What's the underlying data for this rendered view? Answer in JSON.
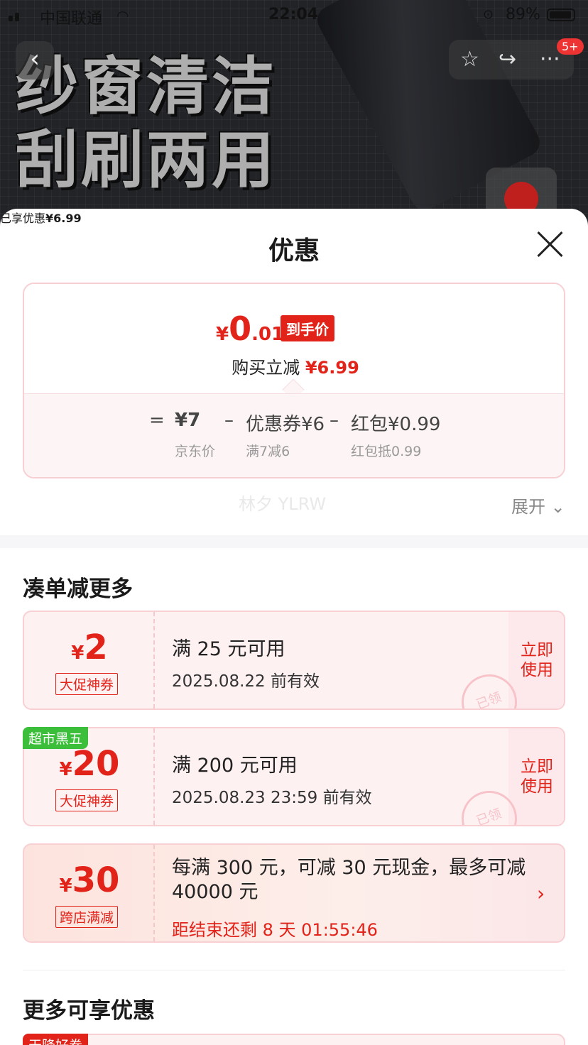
{
  "status_bar": {
    "carrier": "中国联通",
    "time": "22:04",
    "battery": "89%"
  },
  "background": {
    "product_line1": "纱窗清洁",
    "product_line2": "刮刷两用",
    "cart_badge": "5+"
  },
  "sheet": {
    "title": "优惠"
  },
  "price_card": {
    "currency": "¥",
    "price_int": "0",
    "price_dec": ".01",
    "price_tag": "到手价",
    "instant_label": "购买立减",
    "instant_value": "¥6.99",
    "formula": {
      "eq": "=",
      "jd_price": "¥7",
      "jd_price_label": "京东价",
      "minus1": "–",
      "coupon": "优惠券¥6",
      "coupon_label": "满7减6",
      "minus2": "–",
      "redpacket": "红包¥0.99",
      "redpacket_label": "红包抵0.99"
    }
  },
  "enjoyed": {
    "label": "已享优惠",
    "value": "¥6.99",
    "expand": "展开",
    "watermark": "林夕 YLRW"
  },
  "section1": {
    "title": "凑单减更多"
  },
  "coupons": [
    {
      "currency": "¥",
      "amount": "2",
      "type": "大促神券",
      "condition": "满 25 元可用",
      "valid": "2025.08.22 前有效",
      "action1": "立即",
      "action2": "使用",
      "stamp": "已领"
    },
    {
      "tag": "超市黑五",
      "currency": "¥",
      "amount": "20",
      "type": "大促神券",
      "condition": "满 200 元可用",
      "valid": "2025.08.23 23:59 前有效",
      "action1": "立即",
      "action2": "使用",
      "stamp": "已领"
    },
    {
      "currency": "¥",
      "amount": "30",
      "type": "跨店满减",
      "desc": "每满 300 元，可减 30 元现金，最多可减 40000 元",
      "countdown": "距结束还剩 8 天 01:55:46"
    }
  ],
  "section2": {
    "title": "更多可享优惠",
    "tag": "天降好券"
  },
  "colors": {
    "accent": "#e2231a",
    "green_tag": "#3bbf3b"
  }
}
